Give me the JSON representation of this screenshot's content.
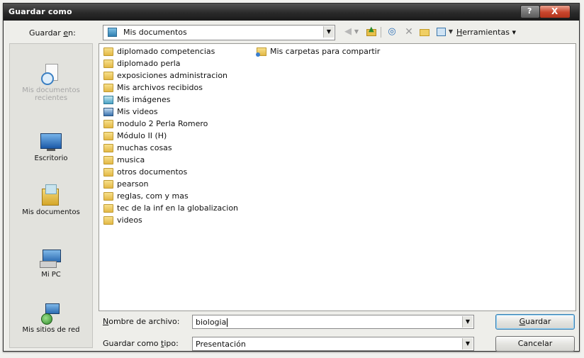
{
  "window": {
    "title": "Guardar como",
    "help_glyph": "?",
    "close_glyph": "X"
  },
  "toolbar": {
    "save_in_label_pre": "Guardar ",
    "save_in_label_key": "e",
    "save_in_label_post": "n:",
    "location": "Mis documentos",
    "tools_key": "H",
    "tools_rest": "erramientas",
    "tools_arrow": "▾"
  },
  "places": [
    {
      "id": "recent",
      "label": "Mis documentos recientes"
    },
    {
      "id": "desktop",
      "label": "Escritorio"
    },
    {
      "id": "documents",
      "label": "Mis documentos"
    },
    {
      "id": "computer",
      "label": "Mi PC"
    },
    {
      "id": "network",
      "label": "Mis sitios de red"
    }
  ],
  "files": {
    "column1": [
      {
        "name": "diplomado competencias",
        "icon": "folder-icon"
      },
      {
        "name": "diplomado perla",
        "icon": "folder-icon"
      },
      {
        "name": "exposiciones administracion",
        "icon": "folder-icon"
      },
      {
        "name": "Mis archivos recibidos",
        "icon": "folder-icon"
      },
      {
        "name": "Mis imágenes",
        "icon": "pictures-folder-icon"
      },
      {
        "name": "Mis videos",
        "icon": "videos-folder-icon"
      },
      {
        "name": "modulo 2 Perla Romero",
        "icon": "folder-icon"
      },
      {
        "name": "Módulo II (H)",
        "icon": "folder-icon"
      },
      {
        "name": "muchas cosas",
        "icon": "folder-icon"
      },
      {
        "name": "musica",
        "icon": "folder-icon"
      },
      {
        "name": "otros documentos",
        "icon": "folder-icon"
      },
      {
        "name": "pearson",
        "icon": "folder-icon"
      },
      {
        "name": "reglas, com y mas",
        "icon": "folder-icon"
      },
      {
        "name": "tec de la inf en la globalizacion",
        "icon": "folder-icon"
      },
      {
        "name": "videos",
        "icon": "folder-icon"
      }
    ],
    "column2": [
      {
        "name": "Mis carpetas para compartir",
        "icon": "shared-folder-icon"
      }
    ]
  },
  "footer": {
    "filename_label_key": "N",
    "filename_label_rest": "ombre de archivo:",
    "filename_value": "biologia",
    "filetype_label_pre": "Guardar como ",
    "filetype_label_key": "t",
    "filetype_label_post": "ipo:",
    "filetype_value": "Presentación",
    "save_key": "G",
    "save_rest": "uardar",
    "cancel_label": "Cancelar"
  }
}
